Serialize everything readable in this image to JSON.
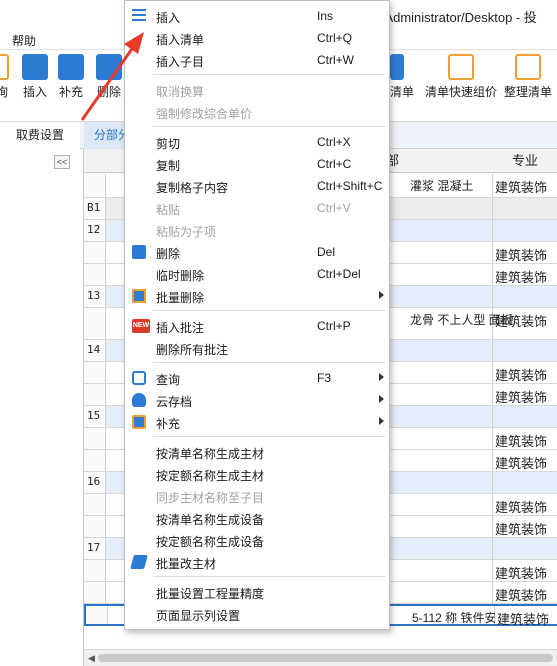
{
  "window": {
    "title": "rs/Administrator/Desktop - 投"
  },
  "menubar": {
    "help": "帮助"
  },
  "ribbon": {
    "left_partial": "询",
    "insert": "插入",
    "supplement": "补充",
    "delete": "删除",
    "insert_list_partial": "清单",
    "quick_price": "清单快速组价",
    "organize_list": "整理清单"
  },
  "tabs": {
    "fee_settings": "取费设置",
    "partial": "分部分"
  },
  "grid": {
    "header_section": "部",
    "header_profession": "专业",
    "rows": [
      {
        "num": "",
        "text": "灌浆 混凝土",
        "prof": "建筑装饰",
        "style": "white",
        "h": 24
      },
      {
        "num": "B1",
        "text": "",
        "prof": "",
        "style": "gray",
        "h": 22
      },
      {
        "num": "12",
        "text": "",
        "prof": "",
        "style": "blue",
        "h": 22
      },
      {
        "num": "",
        "text": "",
        "prof": "建筑装饰",
        "style": "white",
        "h": 22
      },
      {
        "num": "",
        "text": "",
        "prof": "建筑装饰",
        "style": "white",
        "h": 22
      },
      {
        "num": "13",
        "text": "",
        "prof": "",
        "style": "blue",
        "h": 22
      },
      {
        "num": "",
        "text": "龙骨 不上人型 面板",
        "prof": "建筑装饰",
        "style": "white",
        "h": 32
      },
      {
        "num": "14",
        "text": "",
        "prof": "",
        "style": "blue",
        "h": 22
      },
      {
        "num": "",
        "text": "",
        "prof": "建筑装饰",
        "style": "white",
        "h": 22
      },
      {
        "num": "",
        "text": "",
        "prof": "建筑装饰",
        "style": "white",
        "h": 22
      },
      {
        "num": "15",
        "text": "",
        "prof": "",
        "style": "blue",
        "h": 22
      },
      {
        "num": "",
        "text": "",
        "prof": "建筑装饰",
        "style": "white",
        "h": 22
      },
      {
        "num": "",
        "text": "",
        "prof": "建筑装饰",
        "style": "white",
        "h": 22
      },
      {
        "num": "16",
        "text": "",
        "prof": "",
        "style": "blue",
        "h": 22
      },
      {
        "num": "",
        "text": "",
        "prof": "建筑装饰",
        "style": "white",
        "h": 22
      },
      {
        "num": "",
        "text": "",
        "prof": "建筑装饰",
        "style": "white",
        "h": 22
      },
      {
        "num": "17",
        "text": "",
        "prof": "",
        "style": "blue",
        "h": 22
      },
      {
        "num": "",
        "text": "",
        "prof": "建筑装饰",
        "style": "white",
        "h": 22
      },
      {
        "num": "",
        "text": "",
        "prof": "建筑装饰",
        "style": "white",
        "h": 22
      },
      {
        "num": "",
        "text": "5-112  称  铁件安装",
        "prof": "建筑装饰",
        "style": "sel",
        "h": 22
      }
    ]
  },
  "context_menu": {
    "items": [
      {
        "label": "插入",
        "shortcut": "Ins",
        "icon": "list-icon",
        "disabled": false,
        "submenu": false
      },
      {
        "label": "插入清单",
        "shortcut": "Ctrl+Q",
        "icon": "",
        "disabled": false,
        "submenu": false
      },
      {
        "label": "插入子目",
        "shortcut": "Ctrl+W",
        "icon": "",
        "disabled": false,
        "submenu": false
      },
      {
        "sep": true
      },
      {
        "label": "取消换算",
        "shortcut": "",
        "icon": "",
        "disabled": true,
        "submenu": false
      },
      {
        "label": "强制修改综合单价",
        "shortcut": "",
        "icon": "",
        "disabled": true,
        "submenu": false
      },
      {
        "sep": true
      },
      {
        "label": "剪切",
        "shortcut": "Ctrl+X",
        "icon": "",
        "disabled": false,
        "submenu": false
      },
      {
        "label": "复制",
        "shortcut": "Ctrl+C",
        "icon": "",
        "disabled": false,
        "submenu": false
      },
      {
        "label": "复制格子内容",
        "shortcut": "Ctrl+Shift+C",
        "icon": "",
        "disabled": false,
        "submenu": false
      },
      {
        "label": "粘贴",
        "shortcut": "Ctrl+V",
        "icon": "",
        "disabled": true,
        "submenu": false
      },
      {
        "label": "粘贴为子项",
        "shortcut": "",
        "icon": "",
        "disabled": true,
        "submenu": false
      },
      {
        "label": "删除",
        "shortcut": "Del",
        "icon": "trash-icon",
        "disabled": false,
        "submenu": false
      },
      {
        "label": "临时删除",
        "shortcut": "Ctrl+Del",
        "icon": "",
        "disabled": false,
        "submenu": false
      },
      {
        "label": "批量删除",
        "shortcut": "",
        "icon": "batch-delete-icon",
        "disabled": false,
        "submenu": true
      },
      {
        "sep": true
      },
      {
        "label": "插入批注",
        "shortcut": "Ctrl+P",
        "icon": "new-icon",
        "disabled": false,
        "submenu": false
      },
      {
        "label": "删除所有批注",
        "shortcut": "",
        "icon": "",
        "disabled": false,
        "submenu": false
      },
      {
        "sep": true
      },
      {
        "label": "查询",
        "shortcut": "F3",
        "icon": "search-icon",
        "disabled": false,
        "submenu": true
      },
      {
        "label": "云存档",
        "shortcut": "",
        "icon": "cloud-icon",
        "disabled": false,
        "submenu": true
      },
      {
        "label": "补充",
        "shortcut": "",
        "icon": "add-icon",
        "disabled": false,
        "submenu": true
      },
      {
        "sep": true
      },
      {
        "label": "按清单名称生成主材",
        "shortcut": "",
        "icon": "",
        "disabled": false,
        "submenu": false
      },
      {
        "label": "按定额名称生成主材",
        "shortcut": "",
        "icon": "",
        "disabled": false,
        "submenu": false
      },
      {
        "label": "同步主材名称至子目",
        "shortcut": "",
        "icon": "",
        "disabled": true,
        "submenu": false
      },
      {
        "label": "按清单名称生成设备",
        "shortcut": "",
        "icon": "",
        "disabled": false,
        "submenu": false
      },
      {
        "label": "按定额名称生成设备",
        "shortcut": "",
        "icon": "",
        "disabled": false,
        "submenu": false
      },
      {
        "label": "批量改主材",
        "shortcut": "",
        "icon": "edit-icon",
        "disabled": false,
        "submenu": false
      },
      {
        "sep": true
      },
      {
        "label": "批量设置工程量精度",
        "shortcut": "",
        "icon": "",
        "disabled": false,
        "submenu": false
      },
      {
        "label": "页面显示列设置",
        "shortcut": "",
        "icon": "",
        "disabled": false,
        "submenu": false
      }
    ]
  },
  "colors": {
    "accent": "#2b74c9",
    "arrow": "#e8392b",
    "row_blue": "#e4eefa"
  }
}
